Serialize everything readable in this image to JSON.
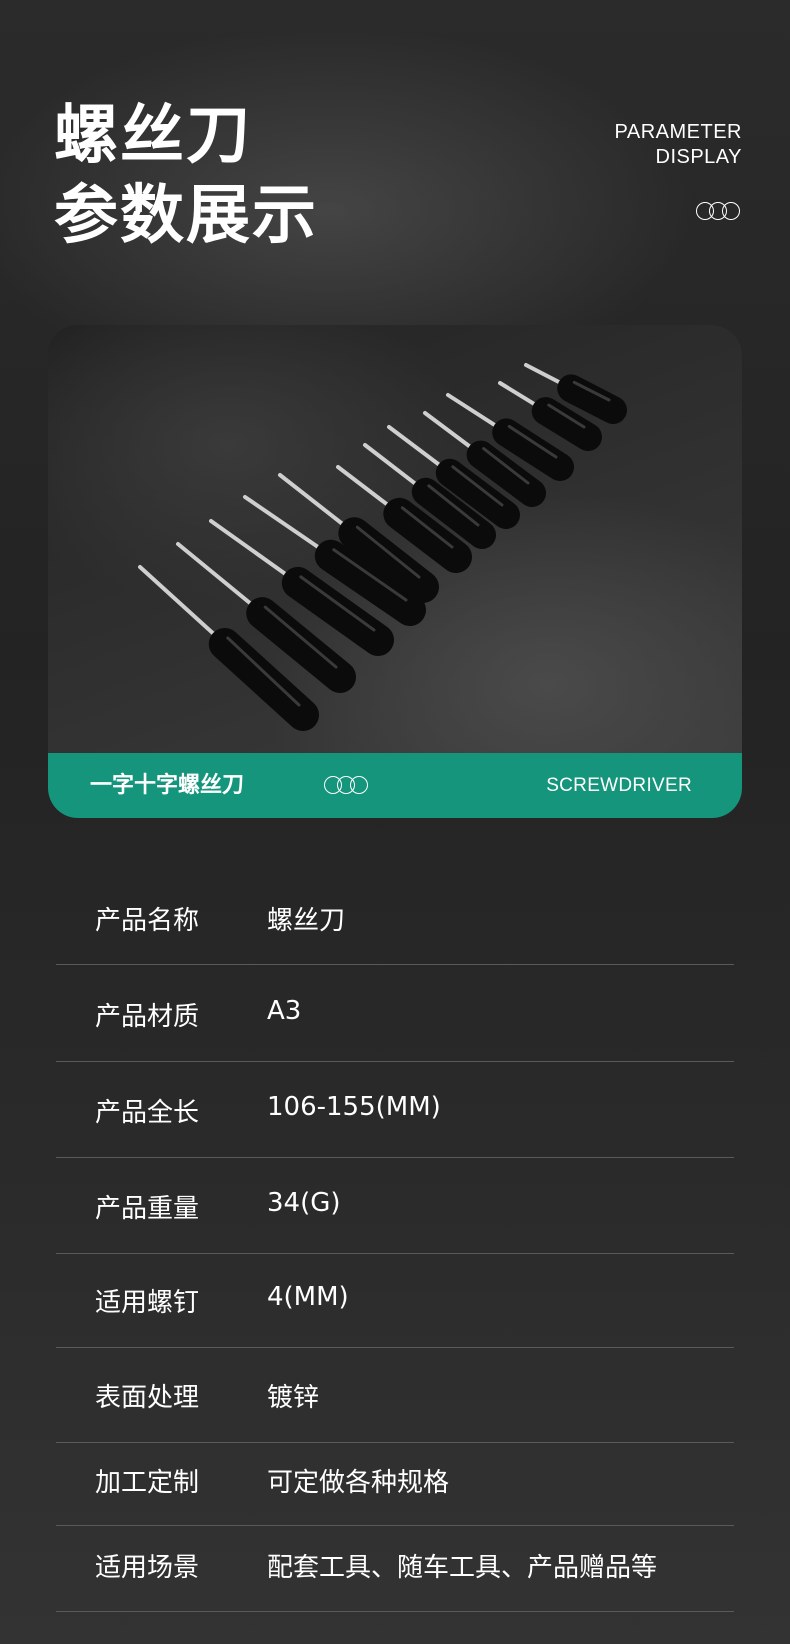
{
  "header": {
    "title_line1": "螺丝刀",
    "title_line2": "参数展示",
    "en_line1": "PARAMETER",
    "en_line2": "DISPLAY"
  },
  "banner": {
    "cn_label": "一字十字螺丝刀",
    "en_label": "SCREWDRIVER",
    "accent_color": "#14957c"
  },
  "specs": [
    {
      "key": "产品名称",
      "value": "螺丝刀"
    },
    {
      "key": "产品材质",
      "value": "A3"
    },
    {
      "key": "产品全长",
      "value": "106-155(MM)"
    },
    {
      "key": "产品重量",
      "value": "34(G)"
    },
    {
      "key": "适用螺钉",
      "value": "4(MM)"
    },
    {
      "key": "表面处理",
      "value": "镀锌"
    },
    {
      "key": "加工定制",
      "value": "可定做各种规格"
    },
    {
      "key": "适用场景",
      "value": "配套工具、随车工具、产品赠品等"
    }
  ]
}
